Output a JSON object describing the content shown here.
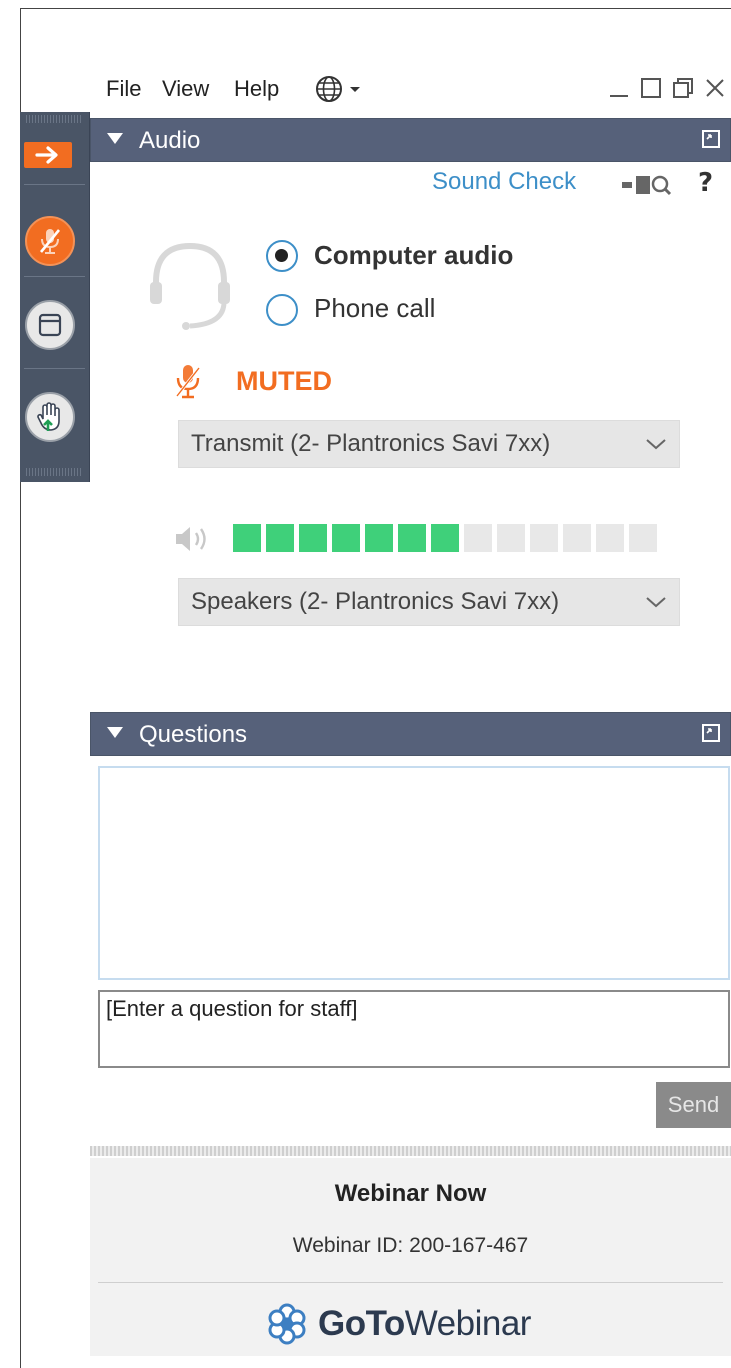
{
  "menubar": {
    "file": "File",
    "view": "View",
    "help": "Help",
    "language_icon": "globe-icon"
  },
  "window_controls": {
    "minimize": "minimize-icon",
    "restore": "restore-icon",
    "close": "close-icon"
  },
  "sidebar": {
    "items": [
      {
        "icon": "arrow-right-icon"
      },
      {
        "icon": "muted-mic-icon"
      },
      {
        "icon": "window-icon"
      },
      {
        "icon": "raise-hand-icon"
      }
    ]
  },
  "audio": {
    "header": "Audio",
    "sound_check": "Sound Check",
    "help": "?",
    "options": [
      {
        "label": "Computer audio",
        "selected": true
      },
      {
        "label": "Phone call",
        "selected": false
      }
    ],
    "status": "MUTED",
    "transmit_device": "Transmit (2- Plantronics Savi 7xx)",
    "speaker_device": "Speakers (2- Plantronics Savi 7xx)",
    "meter_level": 7,
    "meter_total": 13
  },
  "questions": {
    "header": "Questions",
    "input_placeholder": "[Enter a question for staff]",
    "send": "Send"
  },
  "footer": {
    "webinar_name": "Webinar Now",
    "webinar_id": "Webinar ID: 200-167-467",
    "brand_bold": "GoTo",
    "brand_light": "Webinar"
  },
  "colors": {
    "accent_orange": "#f26d21",
    "header_slate": "#56617a",
    "link_blue": "#3d8fc8",
    "meter_green": "#3fd07a"
  }
}
